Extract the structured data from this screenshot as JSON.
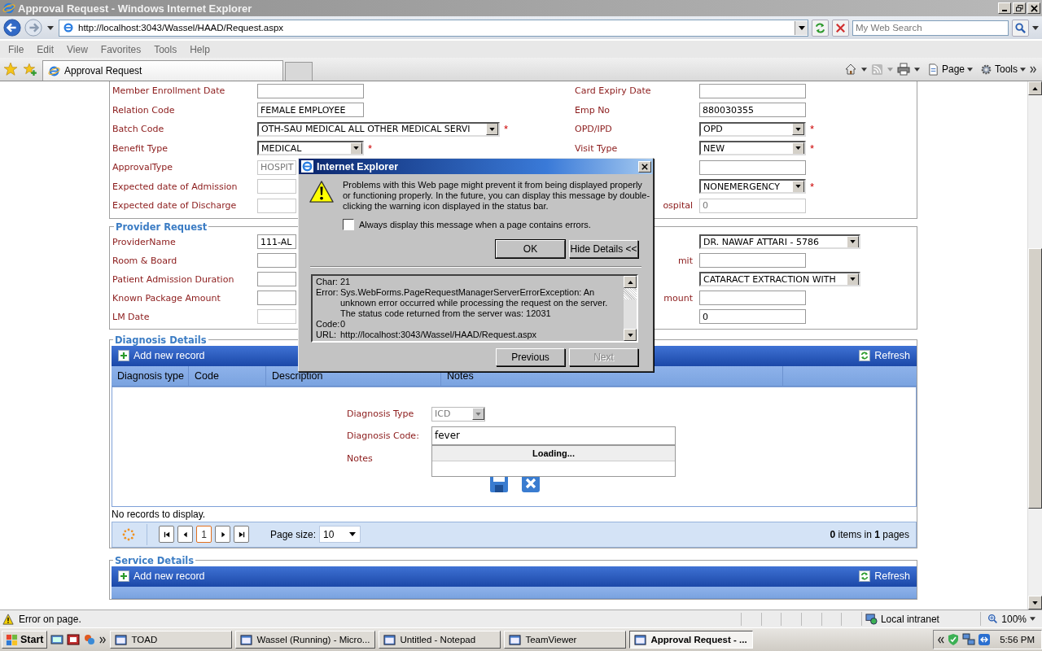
{
  "window": {
    "title": "Approval Request - Windows Internet Explorer"
  },
  "address_bar": {
    "url": "http://localhost:3043/Wassel/HAAD/Request.aspx",
    "search_placeholder": "My Web Search"
  },
  "menu": [
    "File",
    "Edit",
    "View",
    "Favorites",
    "Tools",
    "Help"
  ],
  "tabs": [
    {
      "label": "Approval Request",
      "selected": true
    }
  ],
  "command_bar": [
    "Page",
    "Tools"
  ],
  "member_form": {
    "rows": [
      {
        "cells": [
          {
            "label": "Member Enrollment Date",
            "kind": "text",
            "disabled": false,
            "clipped": false
          },
          {
            "label": "Card Expiry Date",
            "kind": "text",
            "disabled": false,
            "clipped": false
          }
        ]
      },
      {
        "cells": [
          {
            "label": "Relation Code",
            "kind": "text",
            "value": "FEMALE EMPLOYEE",
            "disabled": false,
            "clipped": false
          },
          {
            "label": "Emp No",
            "kind": "text",
            "value": "880030355",
            "disabled": false,
            "clipped": false
          }
        ]
      },
      {
        "cells": [
          {
            "label": "Batch Code",
            "kind": "select",
            "value": "OTH-SAU MEDICAL ALL OTHER MEDICAL SERVI",
            "required_mark": "*",
            "disabled": false,
            "clipped": false
          },
          {
            "label": "OPD/IPD",
            "kind": "select",
            "value": "OPD",
            "required_mark": "*",
            "disabled": false,
            "clipped": false
          }
        ]
      },
      {
        "cells": [
          {
            "label": "Benefit Type",
            "kind": "select",
            "value": "MEDICAL",
            "required_mark": "*",
            "disabled": false,
            "clipped": false
          },
          {
            "label": "Visit Type",
            "kind": "select",
            "value": "NEW",
            "required_mark": "*",
            "disabled": false,
            "clipped": false
          }
        ]
      },
      {
        "cells": [
          {
            "label": "ApprovalType",
            "kind": "text",
            "value": "HOSPIT",
            "disabled": true,
            "clipped": true
          },
          {
            "kind": "text",
            "disabled": false,
            "clipped": false
          }
        ]
      },
      {
        "cells": [
          {
            "label": "Expected date of Admission",
            "kind": "text",
            "disabled": true,
            "clipped": true
          },
          {
            "kind": "select",
            "value": "NONEMERGENCY",
            "required_mark": "*",
            "disabled": false,
            "clipped": false
          }
        ]
      },
      {
        "cells": [
          {
            "label": "Expected date of Discharge",
            "kind": "text",
            "disabled": true,
            "clipped": true
          },
          {
            "label": "ospital",
            "label_clipped": true,
            "kind": "text",
            "value": "0",
            "disabled": true,
            "clipped": false
          }
        ]
      }
    ]
  },
  "provider_request": {
    "legend": "Provider Request",
    "rows": [
      {
        "cells": [
          {
            "label": "ProviderName",
            "kind": "text",
            "value": "111-AL",
            "disabled": false,
            "clipped": true
          },
          {
            "kind": "select",
            "value": "DR. NAWAF ATTARI - 5786",
            "disabled": false,
            "clipped": false
          }
        ]
      },
      {
        "cells": [
          {
            "label": "Room & Board",
            "kind": "text",
            "disabled": false,
            "clipped": true
          },
          {
            "label": "mit",
            "label_clipped": true,
            "kind": "text",
            "disabled": false,
            "clipped": false
          }
        ]
      },
      {
        "cells": [
          {
            "label": "Patient Admission Duration",
            "kind": "text",
            "disabled": false,
            "clipped": true
          },
          {
            "kind": "select",
            "value": "CATARACT EXTRACTION WITH",
            "disabled": false,
            "clipped": false
          }
        ]
      },
      {
        "cells": [
          {
            "label": "Known Package Amount",
            "kind": "text",
            "disabled": false,
            "clipped": true
          },
          {
            "label": "mount",
            "label_clipped": true,
            "kind": "text",
            "disabled": false,
            "clipped": false
          }
        ]
      },
      {
        "cells": [
          {
            "label": "LM Date",
            "kind": "text",
            "disabled": true,
            "clipped": true
          },
          {
            "kind": "text",
            "value": "0",
            "disabled": false,
            "clipped": false
          }
        ]
      }
    ]
  },
  "diagnosis_details": {
    "legend": "Diagnosis Details",
    "add_label": "Add new record",
    "refresh_label": "Refresh",
    "columns": [
      "Diagnosis type",
      "Code",
      "Description",
      "Notes"
    ],
    "edit_form": {
      "type_label": "Diagnosis Type",
      "type_value": "ICD",
      "code_label": "Diagnosis Code:",
      "code_value": "fever",
      "loading_text": "Loading...",
      "notes_label": "Notes"
    },
    "empty_text": "No records to display.",
    "pager": {
      "pages": [
        {
          "label": "1",
          "selected": true
        }
      ],
      "page_size_label": "Page size:",
      "page_size": "10",
      "summary": "**0** items in **1** pages"
    }
  },
  "service_details": {
    "legend": "Service Details",
    "add_label": "Add new record",
    "refresh_label": "Refresh"
  },
  "dialog": {
    "title": "Internet Explorer",
    "message": "Problems with this Web page might prevent it from being displayed properly or functioning properly. In the future, you can display this message by double-clicking the warning icon displayed in the status bar.",
    "checkbox": {
      "label": "Always display this message when a page contains errors.",
      "checked": false
    },
    "ok": "OK",
    "details_button": "Hide Details <<",
    "details": [
      {
        "key": "Char:",
        "value": "21"
      },
      {
        "key": "Error:",
        "value": "Sys.WebForms.PageRequestManagerServerErrorException: An unknown error occurred while processing the request on the server. The status code returned from the server was: 12031"
      },
      {
        "key": "Code:",
        "value": "0"
      },
      {
        "key": "URL:",
        "value": "http://localhost:3043/Wassel/HAAD/Request.aspx"
      }
    ],
    "previous": {
      "label": "Previous",
      "disabled": false
    },
    "next": {
      "label": "Next",
      "disabled": true
    }
  },
  "status_bar": {
    "message": "Error on page.",
    "zone": "Local intranet",
    "zoom": "100%"
  },
  "taskbar": {
    "start": "Start",
    "buttons": [
      {
        "label": "TOAD",
        "selected": false
      },
      {
        "label": "Wassel (Running) - Micro...",
        "selected": false
      },
      {
        "label": "Untitled - Notepad",
        "selected": false
      },
      {
        "label": "TeamViewer",
        "selected": false
      },
      {
        "label": "Approval Request - ...",
        "selected": true
      }
    ],
    "clock": "5:56 PM"
  }
}
